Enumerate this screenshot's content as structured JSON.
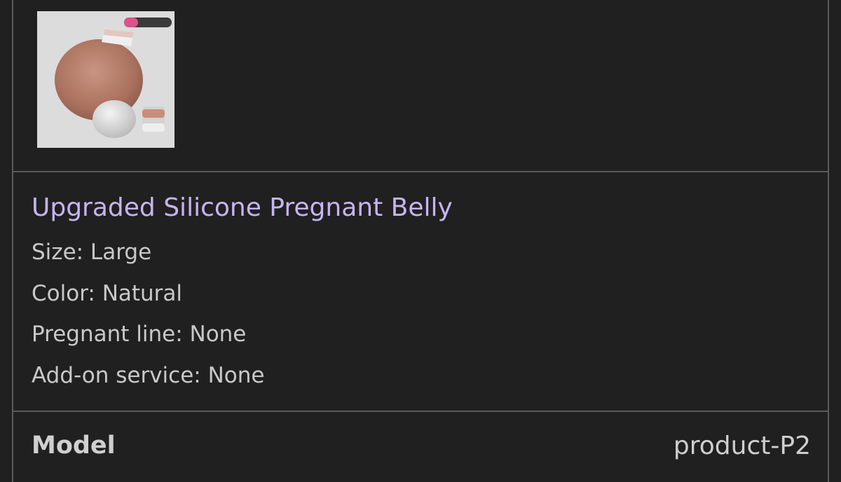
{
  "product": {
    "image_name": "silicone-pregnant-belly-thumbnail",
    "title": "Upgraded Silicone Pregnant Belly",
    "options": [
      "Size: Large",
      "Color: Natural",
      "Pregnant line: None",
      "Add-on service: None"
    ]
  },
  "model": {
    "label": "Model",
    "value": "product-P2"
  },
  "colors": {
    "background": "#202020",
    "border": "#5a5a5a",
    "link": "#c4b6f2",
    "text": "#c9c9c9",
    "thumb_background": "#dcdcdc"
  }
}
